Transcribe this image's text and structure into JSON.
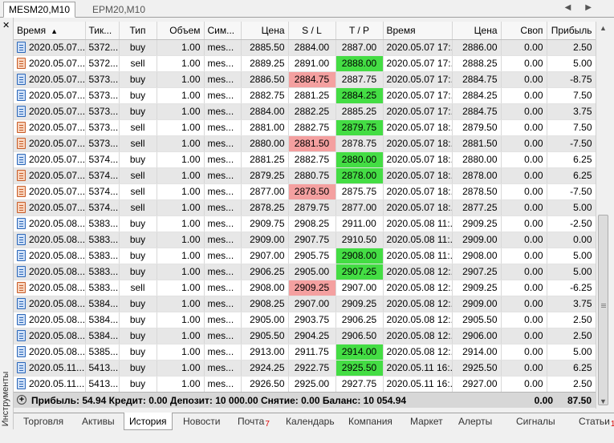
{
  "chart_tabs": [
    {
      "label": "MESM20,M10",
      "active": true
    },
    {
      "label": "EPM20,M10",
      "active": false
    }
  ],
  "panel_title": "Инструменты",
  "columns": [
    "Время",
    "Тикет",
    "Тип",
    "Объем",
    "Символ",
    "Цена",
    "S / L",
    "T / P",
    "Время",
    "Цена",
    "Своп",
    "Прибыль"
  ],
  "column_display": [
    "Время",
    "Тик...",
    "Тип",
    "Объем",
    "Сим...",
    "Цена",
    "S / L",
    "T / P",
    "Время",
    "Цена",
    "Своп",
    "Прибыль"
  ],
  "rows": [
    {
      "t1": "2020.05.07...",
      "ticket": "5372...",
      "type": "buy",
      "vol": "1.00",
      "sym": "mes...",
      "price": "2885.50",
      "sl": "2884.00",
      "tp": "2887.00",
      "t2": "2020.05.07 17:...",
      "close": "2886.00",
      "swap": "0.00",
      "profit": "2.50",
      "hl": ""
    },
    {
      "t1": "2020.05.07...",
      "ticket": "5372...",
      "type": "sell",
      "vol": "1.00",
      "sym": "mes...",
      "price": "2889.25",
      "sl": "2891.00",
      "tp": "2888.00",
      "t2": "2020.05.07 17:...",
      "close": "2888.25",
      "swap": "0.00",
      "profit": "5.00",
      "hl": "tp"
    },
    {
      "t1": "2020.05.07...",
      "ticket": "5373...",
      "type": "buy",
      "vol": "1.00",
      "sym": "mes...",
      "price": "2886.50",
      "sl": "2884.75",
      "tp": "2887.75",
      "t2": "2020.05.07 17:...",
      "close": "2884.75",
      "swap": "0.00",
      "profit": "-8.75",
      "hl": "sl"
    },
    {
      "t1": "2020.05.07...",
      "ticket": "5373...",
      "type": "buy",
      "vol": "1.00",
      "sym": "mes...",
      "price": "2882.75",
      "sl": "2881.25",
      "tp": "2884.25",
      "t2": "2020.05.07 17:...",
      "close": "2884.25",
      "swap": "0.00",
      "profit": "7.50",
      "hl": "tp"
    },
    {
      "t1": "2020.05.07...",
      "ticket": "5373...",
      "type": "buy",
      "vol": "1.00",
      "sym": "mes...",
      "price": "2884.00",
      "sl": "2882.25",
      "tp": "2885.25",
      "t2": "2020.05.07 17:...",
      "close": "2884.75",
      "swap": "0.00",
      "profit": "3.75",
      "hl": ""
    },
    {
      "t1": "2020.05.07...",
      "ticket": "5373...",
      "type": "sell",
      "vol": "1.00",
      "sym": "mes...",
      "price": "2881.00",
      "sl": "2882.75",
      "tp": "2879.75",
      "t2": "2020.05.07 18:...",
      "close": "2879.50",
      "swap": "0.00",
      "profit": "7.50",
      "hl": "tp"
    },
    {
      "t1": "2020.05.07...",
      "ticket": "5373...",
      "type": "sell",
      "vol": "1.00",
      "sym": "mes...",
      "price": "2880.00",
      "sl": "2881.50",
      "tp": "2878.75",
      "t2": "2020.05.07 18:...",
      "close": "2881.50",
      "swap": "0.00",
      "profit": "-7.50",
      "hl": "sl"
    },
    {
      "t1": "2020.05.07...",
      "ticket": "5374...",
      "type": "buy",
      "vol": "1.00",
      "sym": "mes...",
      "price": "2881.25",
      "sl": "2882.75",
      "tp": "2880.00",
      "t2": "2020.05.07 18:...",
      "close": "2880.00",
      "swap": "0.00",
      "profit": "6.25",
      "hl": "tp"
    },
    {
      "t1": "2020.05.07...",
      "ticket": "5374...",
      "type": "sell",
      "vol": "1.00",
      "sym": "mes...",
      "price": "2879.25",
      "sl": "2880.75",
      "tp": "2878.00",
      "t2": "2020.05.07 18:...",
      "close": "2878.00",
      "swap": "0.00",
      "profit": "6.25",
      "hl": "tp"
    },
    {
      "t1": "2020.05.07...",
      "ticket": "5374...",
      "type": "sell",
      "vol": "1.00",
      "sym": "mes...",
      "price": "2877.00",
      "sl": "2878.50",
      "tp": "2875.75",
      "t2": "2020.05.07 18:...",
      "close": "2878.50",
      "swap": "0.00",
      "profit": "-7.50",
      "hl": "sl"
    },
    {
      "t1": "2020.05.07...",
      "ticket": "5374...",
      "type": "sell",
      "vol": "1.00",
      "sym": "mes...",
      "price": "2878.25",
      "sl": "2879.75",
      "tp": "2877.00",
      "t2": "2020.05.07 18:...",
      "close": "2877.25",
      "swap": "0.00",
      "profit": "5.00",
      "hl": ""
    },
    {
      "t1": "2020.05.08...",
      "ticket": "5383...",
      "type": "buy",
      "vol": "1.00",
      "sym": "mes...",
      "price": "2909.75",
      "sl": "2908.25",
      "tp": "2911.00",
      "t2": "2020.05.08 11:...",
      "close": "2909.25",
      "swap": "0.00",
      "profit": "-2.50",
      "hl": ""
    },
    {
      "t1": "2020.05.08...",
      "ticket": "5383...",
      "type": "buy",
      "vol": "1.00",
      "sym": "mes...",
      "price": "2909.00",
      "sl": "2907.75",
      "tp": "2910.50",
      "t2": "2020.05.08 11:...",
      "close": "2909.00",
      "swap": "0.00",
      "profit": "0.00",
      "hl": ""
    },
    {
      "t1": "2020.05.08...",
      "ticket": "5383...",
      "type": "buy",
      "vol": "1.00",
      "sym": "mes...",
      "price": "2907.00",
      "sl": "2905.75",
      "tp": "2908.00",
      "t2": "2020.05.08 11:...",
      "close": "2908.00",
      "swap": "0.00",
      "profit": "5.00",
      "hl": "tp"
    },
    {
      "t1": "2020.05.08...",
      "ticket": "5383...",
      "type": "buy",
      "vol": "1.00",
      "sym": "mes...",
      "price": "2906.25",
      "sl": "2905.00",
      "tp": "2907.25",
      "t2": "2020.05.08 12:...",
      "close": "2907.25",
      "swap": "0.00",
      "profit": "5.00",
      "hl": "tp"
    },
    {
      "t1": "2020.05.08...",
      "ticket": "5383...",
      "type": "sell",
      "vol": "1.00",
      "sym": "mes...",
      "price": "2908.00",
      "sl": "2909.25",
      "tp": "2907.00",
      "t2": "2020.05.08 12:...",
      "close": "2909.25",
      "swap": "0.00",
      "profit": "-6.25",
      "hl": "sl"
    },
    {
      "t1": "2020.05.08...",
      "ticket": "5384...",
      "type": "buy",
      "vol": "1.00",
      "sym": "mes...",
      "price": "2908.25",
      "sl": "2907.00",
      "tp": "2909.25",
      "t2": "2020.05.08 12:...",
      "close": "2909.00",
      "swap": "0.00",
      "profit": "3.75",
      "hl": ""
    },
    {
      "t1": "2020.05.08...",
      "ticket": "5384...",
      "type": "buy",
      "vol": "1.00",
      "sym": "mes...",
      "price": "2905.00",
      "sl": "2903.75",
      "tp": "2906.25",
      "t2": "2020.05.08 12:...",
      "close": "2905.50",
      "swap": "0.00",
      "profit": "2.50",
      "hl": ""
    },
    {
      "t1": "2020.05.08...",
      "ticket": "5384...",
      "type": "buy",
      "vol": "1.00",
      "sym": "mes...",
      "price": "2905.50",
      "sl": "2904.25",
      "tp": "2906.50",
      "t2": "2020.05.08 12:...",
      "close": "2906.00",
      "swap": "0.00",
      "profit": "2.50",
      "hl": ""
    },
    {
      "t1": "2020.05.08...",
      "ticket": "5385...",
      "type": "buy",
      "vol": "1.00",
      "sym": "mes...",
      "price": "2913.00",
      "sl": "2911.75",
      "tp": "2914.00",
      "t2": "2020.05.08 12:...",
      "close": "2914.00",
      "swap": "0.00",
      "profit": "5.00",
      "hl": "tp"
    },
    {
      "t1": "2020.05.11...",
      "ticket": "5413...",
      "type": "buy",
      "vol": "1.00",
      "sym": "mes...",
      "price": "2924.25",
      "sl": "2922.75",
      "tp": "2925.50",
      "t2": "2020.05.11 16:...",
      "close": "2925.50",
      "swap": "0.00",
      "profit": "6.25",
      "hl": "tp"
    },
    {
      "t1": "2020.05.11...",
      "ticket": "5413...",
      "type": "buy",
      "vol": "1.00",
      "sym": "mes...",
      "price": "2926.50",
      "sl": "2925.00",
      "tp": "2927.75",
      "t2": "2020.05.11 16:...",
      "close": "2927.00",
      "swap": "0.00",
      "profit": "2.50",
      "hl": ""
    }
  ],
  "summary": {
    "text": "Прибыль: 54.94  Кредит: 0.00  Депозит: 10 000.00  Снятие: 0.00  Баланс: 10 054.94",
    "swap": "0.00",
    "profit": "87.50"
  },
  "bottom_tabs": [
    {
      "label": "Торговля",
      "badge": ""
    },
    {
      "label": "Активы",
      "badge": ""
    },
    {
      "label": "История",
      "badge": "",
      "active": true
    },
    {
      "label": "Новости",
      "badge": ""
    },
    {
      "label": "Почта",
      "badge": "7"
    },
    {
      "label": "Календарь",
      "badge": ""
    },
    {
      "label": "Компания",
      "badge": ""
    },
    {
      "label": "Маркет",
      "badge": ""
    },
    {
      "label": "Алерты",
      "badge": ""
    },
    {
      "label": "Сигналы",
      "badge": ""
    },
    {
      "label": "Статьи",
      "badge": "1"
    }
  ],
  "colors": {
    "tp_hit": "#44dd44",
    "sl_hit": "#f4a0a0",
    "row_alt": "#e7e7e7"
  }
}
